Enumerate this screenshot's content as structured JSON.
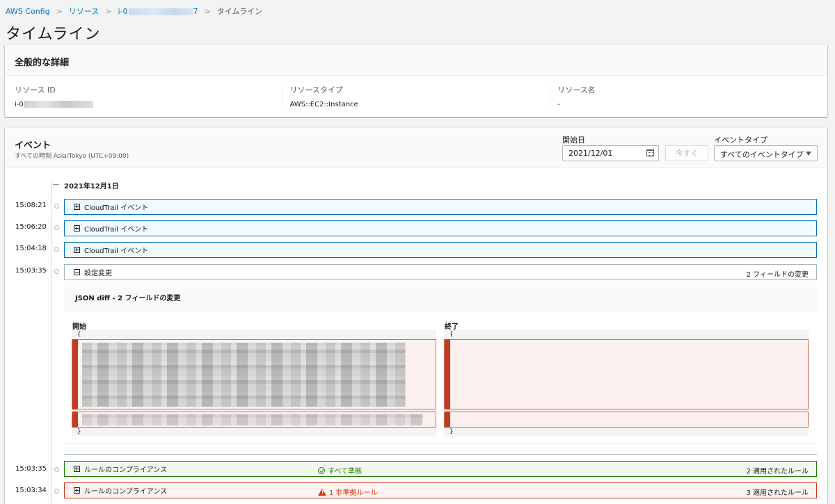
{
  "breadcrumb": {
    "item1": "AWS Config",
    "item2": "リソース",
    "item3_prefix": "i-0",
    "item3_suffix": "7",
    "item4": "タイムライン"
  },
  "page": {
    "title": "タイムライン"
  },
  "general": {
    "title": "全般的な詳細",
    "fields": [
      {
        "label": "リソース ID",
        "value": "i-0"
      },
      {
        "label": "リソースタイプ",
        "value": "AWS::EC2::Instance"
      },
      {
        "label": "リソース名",
        "value": "-"
      }
    ]
  },
  "events": {
    "title": "イベント",
    "subtitle": "すべての時刻 Asia/Tokyo (UTC+09:00)",
    "start_label": "開始日",
    "start_value": "2021/12/01",
    "now_label": "今すぐ",
    "type_label": "イベントタイプ",
    "type_value": "すべてのイベントタイプ",
    "date_heading": "2021年12月1日",
    "rows": [
      {
        "time": "15:08:21",
        "label": "CloudTrail イベント"
      },
      {
        "time": "15:06:20",
        "label": "CloudTrail イベント"
      },
      {
        "time": "15:04:18",
        "label": "CloudTrail イベント"
      },
      {
        "time": "15:03:35",
        "label": "設定変更",
        "right": "2 フィールドの変更"
      },
      {
        "time": "15:03:35",
        "label": "ルールのコンプライアンス",
        "mid": "すべて準拠",
        "right": "2 適用されたルール"
      },
      {
        "time": "15:03:34",
        "label": "ルールのコンプライアンス",
        "mid": "1 非準拠ルール",
        "right": "3 適用されたルール"
      }
    ],
    "diff": {
      "title": "JSON diff - 2 フィールドの変更",
      "before_label": "開始",
      "after_label": "終了",
      "open_brace": "{",
      "close_brace": "}"
    }
  },
  "colors": {
    "link": "#0073bb",
    "success": "#1d8102",
    "error": "#d13212",
    "cloudtrail_bg": "#f1faff"
  }
}
